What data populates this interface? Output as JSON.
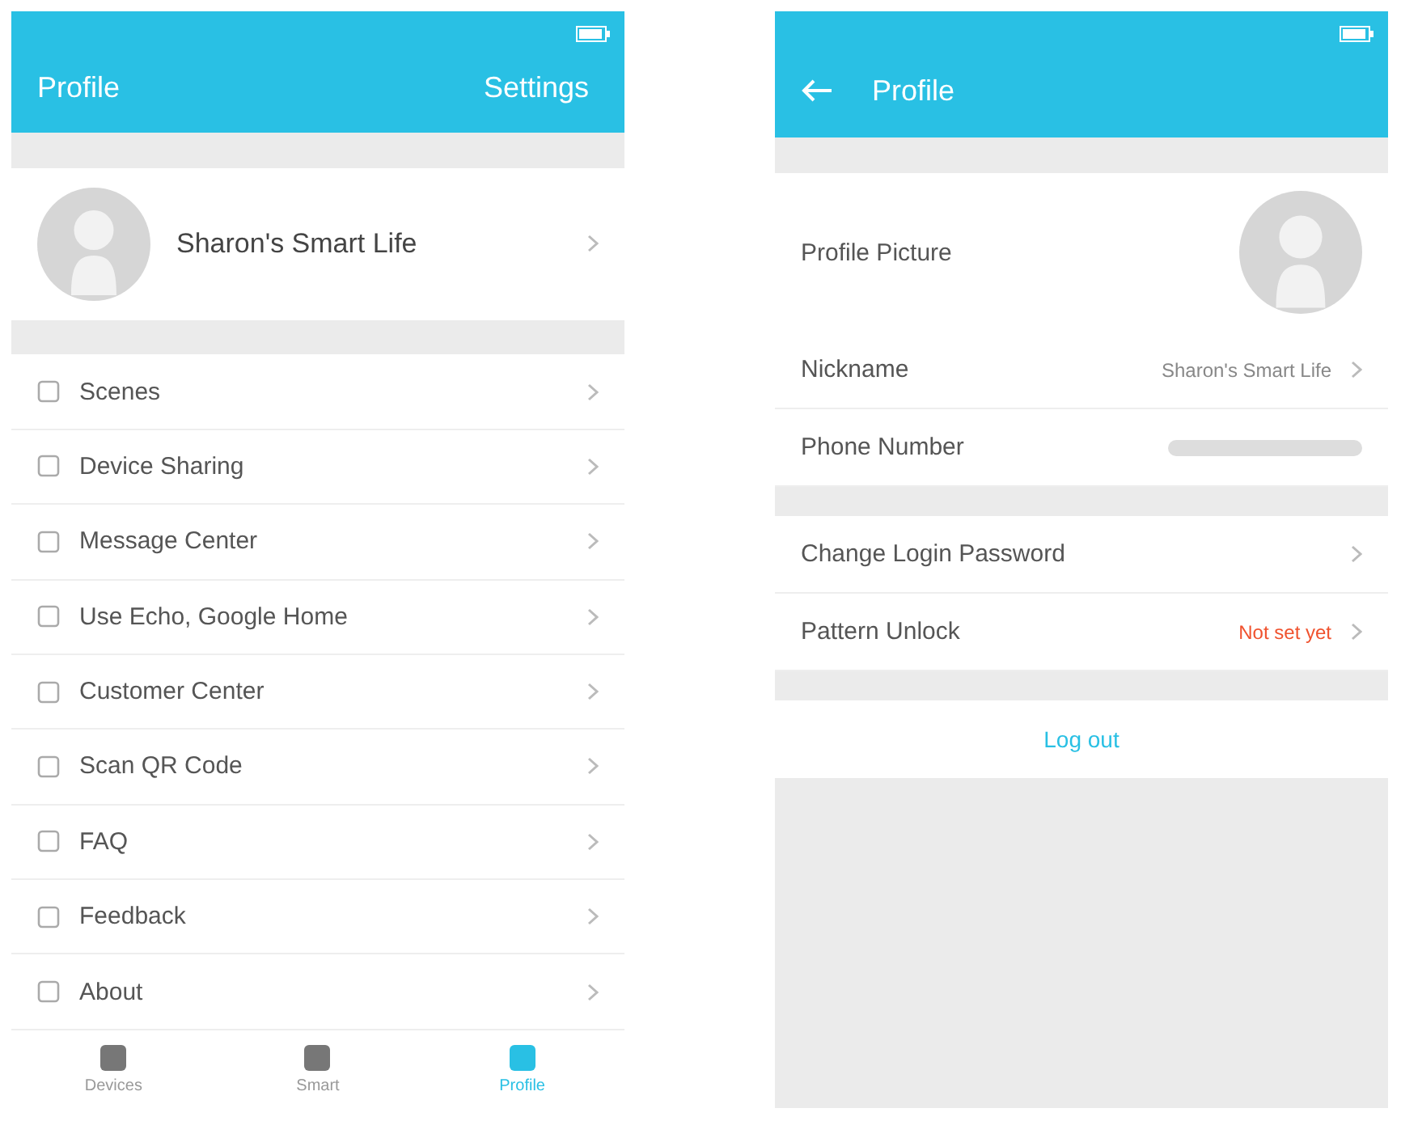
{
  "left_screen": {
    "header": {
      "title": "Profile",
      "action": "Settings"
    },
    "account": {
      "name": "Sharon's Smart Life"
    },
    "menu": [
      {
        "label": "Scenes"
      },
      {
        "label": "Device Sharing"
      },
      {
        "label": "Message Center"
      },
      {
        "label": "Use Echo, Google Home"
      },
      {
        "label": "Customer Center"
      },
      {
        "label": "Scan QR Code"
      },
      {
        "label": "FAQ"
      },
      {
        "label": "Feedback"
      },
      {
        "label": "About"
      }
    ],
    "tabs": [
      {
        "label": "Devices",
        "selected": false
      },
      {
        "label": "Smart",
        "selected": false
      },
      {
        "label": "Profile",
        "selected": true
      }
    ]
  },
  "right_screen": {
    "header": {
      "title": "Profile"
    },
    "rows": [
      {
        "kind": "picture",
        "label": "Profile Picture"
      },
      {
        "kind": "value",
        "label": "Nickname",
        "value": "Sharon's Smart Life"
      },
      {
        "kind": "hidden",
        "label": "Phone Number"
      },
      {
        "kind": "gap"
      },
      {
        "kind": "link",
        "label": "Change Login Password"
      },
      {
        "kind": "warn",
        "label": "Pattern Unlock",
        "value": "Not set yet"
      },
      {
        "kind": "gap"
      }
    ],
    "logout": "Log out"
  }
}
